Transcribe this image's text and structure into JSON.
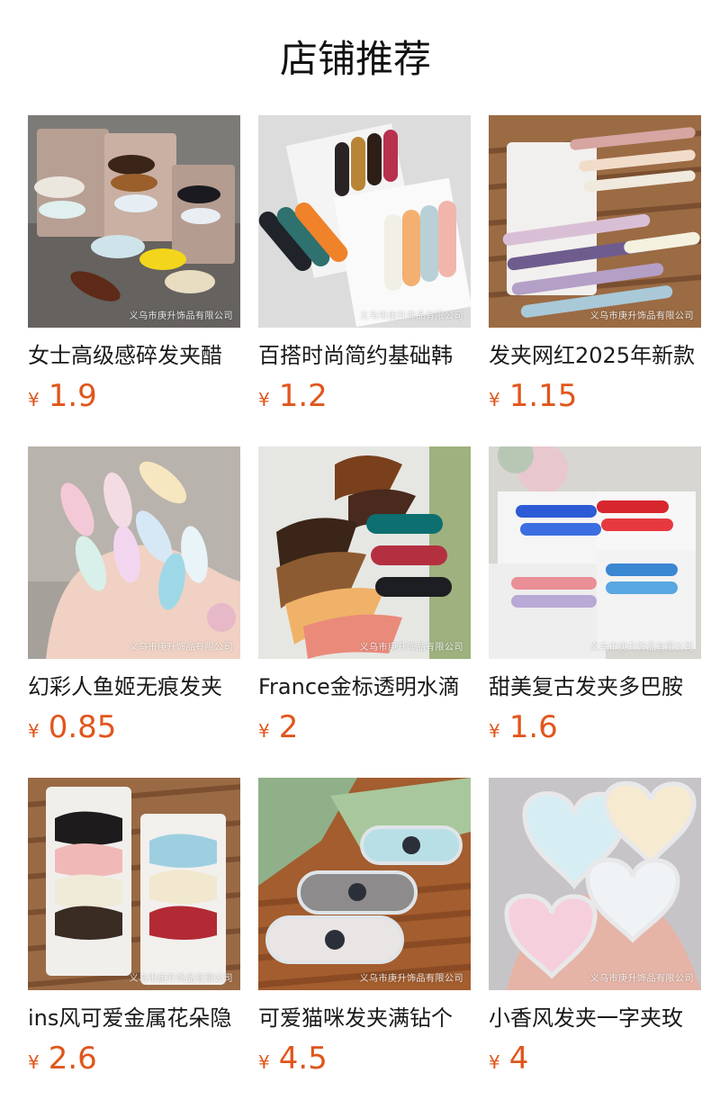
{
  "page": {
    "title": "店铺推荐"
  },
  "colors": {
    "price": "#e0561c",
    "text": "#1a1a1a",
    "background": "#ffffff"
  },
  "products": [
    {
      "title": "女士高级感碎发夹醋",
      "currency": "¥",
      "price": "1.9",
      "watermark": "义乌市庚升饰品有限公司",
      "image_subject": "hair clips on gray card"
    },
    {
      "title": "百搭时尚简约基础韩",
      "currency": "¥",
      "price": "1.2",
      "watermark": "义乌市庚升饰品有限公司",
      "image_subject": "pastel hair clips on white card"
    },
    {
      "title": "发夹网红2025年新款",
      "currency": "¥",
      "price": "1.15",
      "watermark": "义乌市庚升饰品有限公司",
      "image_subject": "long bar clips in basket"
    },
    {
      "title": "幻彩人鱼姬无痕发夹",
      "currency": "¥",
      "price": "0.85",
      "watermark": "义乌市庚升饰品有限公司",
      "image_subject": "iridescent clips in hand"
    },
    {
      "title": "France金标透明水滴",
      "currency": "¥",
      "price": "2",
      "watermark": "义乌市庚升饰品有限公司",
      "image_subject": "teardrop clips on white"
    },
    {
      "title": "甜美复古发夹多巴胺",
      "currency": "¥",
      "price": "1.6",
      "watermark": "义乌市庚升饰品有限公司",
      "image_subject": "blue and red duckbill clips"
    },
    {
      "title": "ins风可爱金属花朵隐",
      "currency": "¥",
      "price": "2.6",
      "watermark": "义乌市庚升饰品有限公司",
      "image_subject": "flower clips on cards"
    },
    {
      "title": "可爱猫咪发夹满钻个",
      "currency": "¥",
      "price": "4.5",
      "watermark": "义乌市庚升饰品有限公司",
      "image_subject": "rhinestone cat clips"
    },
    {
      "title": "小香风发夹一字夹玫",
      "currency": "¥",
      "price": "4",
      "watermark": "义乌市庚升饰品有限公司",
      "image_subject": "heart rhinestone clips in hand"
    }
  ]
}
